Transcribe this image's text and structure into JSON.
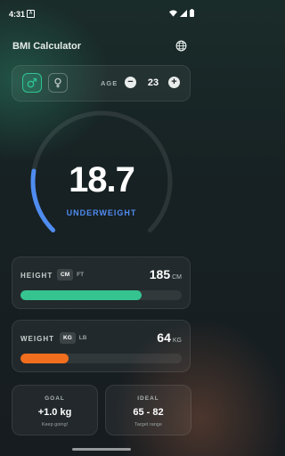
{
  "status_bar": {
    "time": "4:31",
    "notification_icon": "A",
    "icons": [
      "wifi-icon",
      "signal-icon",
      "battery-icon"
    ]
  },
  "app_bar": {
    "title": "BMI Calculator",
    "language_icon": "globe-icon"
  },
  "profile": {
    "gender_selected": "male",
    "male_icon": "male-symbol-icon",
    "female_icon": "female-symbol-icon",
    "age_label": "AGE",
    "age_value": "23",
    "minus_label": "−",
    "plus_label": "+"
  },
  "result": {
    "bmi": "18.7",
    "category": "UNDERWEIGHT",
    "gauge_fraction": 0.2,
    "gauge_color": "#4f8cf0"
  },
  "height": {
    "label": "HEIGHT",
    "units": [
      "CM",
      "FT"
    ],
    "active_unit": "CM",
    "value": "185",
    "unit_label": "CM",
    "bar_fraction": 0.75,
    "bar_color": "#35c38f"
  },
  "weight": {
    "label": "WEIGHT",
    "units": [
      "KG",
      "LB"
    ],
    "active_unit": "KG",
    "value": "64",
    "unit_label": "KG",
    "bar_fraction": 0.3,
    "bar_color": "#f06e1e"
  },
  "goal": {
    "label": "GOAL",
    "value": "+1.0 kg",
    "sub": "Keep going!"
  },
  "ideal": {
    "label": "IDEAL",
    "value": "65 - 82",
    "sub": "Target range"
  }
}
